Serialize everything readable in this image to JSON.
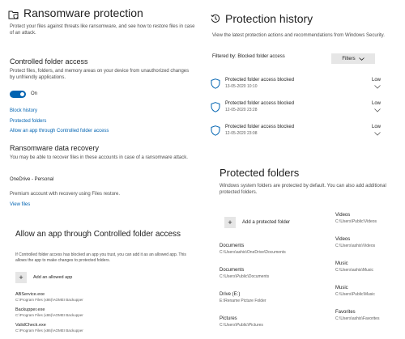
{
  "ransomware": {
    "title": "Ransomware protection",
    "description": "Protect your files against threats like ransomware, and see how to restore files in case of an attack.",
    "controlled_heading": "Controlled folder access",
    "controlled_description": "Protect files, folders, and memory areas on your device from unauthorized changes by unfriendly applications.",
    "toggle_state": "On",
    "links": {
      "block_history": "Block history",
      "protected_folders": "Protected folders",
      "allow_app": "Allow an app through Controlled folder access"
    },
    "recovery_heading": "Ransomware data recovery",
    "recovery_description": "You may be able to recover files in these accounts in case of a ransomware attack.",
    "account": "OneDrive - Personal",
    "account_detail": "Premium account with recovery using Files restore.",
    "view_files": "View files"
  },
  "history": {
    "title": "Protection history",
    "description": "View the latest protection actions and recommendations from Windows Security.",
    "filter_label": "Filtered by: Blocked folder access",
    "filters_button": "Filters",
    "items": [
      {
        "title": "Protected folder access blocked",
        "date": "13-05-2020 10:10",
        "severity": "Low"
      },
      {
        "title": "Protected folder access blocked",
        "date": "12-05-2020 23:28",
        "severity": "Low"
      },
      {
        "title": "Protected folder access blocked",
        "date": "12-05-2020 23:08",
        "severity": "Low"
      }
    ]
  },
  "protected_folders": {
    "title": "Protected folders",
    "description": "Windows system folders are protected by default. You can also add additional protected folders.",
    "add_label": "Add a protected folder",
    "left_column": [
      {
        "name": "Documents",
        "path": "C:\\Users\\ashis\\OneDrive\\Documents"
      },
      {
        "name": "Documents",
        "path": "C:\\Users\\Public\\Documents"
      },
      {
        "name": "Drive (E:)",
        "path": "E:\\Rename Picture Folder"
      },
      {
        "name": "Pictures",
        "path": "C:\\Users\\Public\\Pictures"
      }
    ],
    "right_column": [
      {
        "name": "Videos",
        "path": "C:\\Users\\Public\\Videos"
      },
      {
        "name": "Videos",
        "path": "C:\\Users\\ashis\\Videos"
      },
      {
        "name": "Music",
        "path": "C:\\Users\\ashis\\Music"
      },
      {
        "name": "Music",
        "path": "C:\\Users\\Public\\Music"
      },
      {
        "name": "Favorites",
        "path": "C:\\Users\\ashis\\Favorites"
      }
    ]
  },
  "allow_app": {
    "title": "Allow an app through Controlled folder access",
    "description": "If Controlled folder access has blocked an app you trust, you can add it as an allowed app. This allows the app to make changes to protected folders.",
    "add_label": "Add an allowed app",
    "apps": [
      {
        "name": "ABService.exe",
        "path": "C:\\Program Files (x86)\\AOMEI Backupper"
      },
      {
        "name": "Backupper.exe",
        "path": "C:\\Program Files (x86)\\AOMEI Backupper"
      },
      {
        "name": "ValidCheck.exe",
        "path": "C:\\Program Files (x86)\\AOMEI Backupper"
      }
    ]
  },
  "colors": {
    "accent": "#0063b1",
    "button_bg": "#e6e6e6"
  },
  "icons": {
    "ransomware": "folder-shield-icon",
    "history": "history-clock-icon",
    "entry": "shield-icon",
    "expand": "chevron-down-icon",
    "add": "plus-icon"
  }
}
